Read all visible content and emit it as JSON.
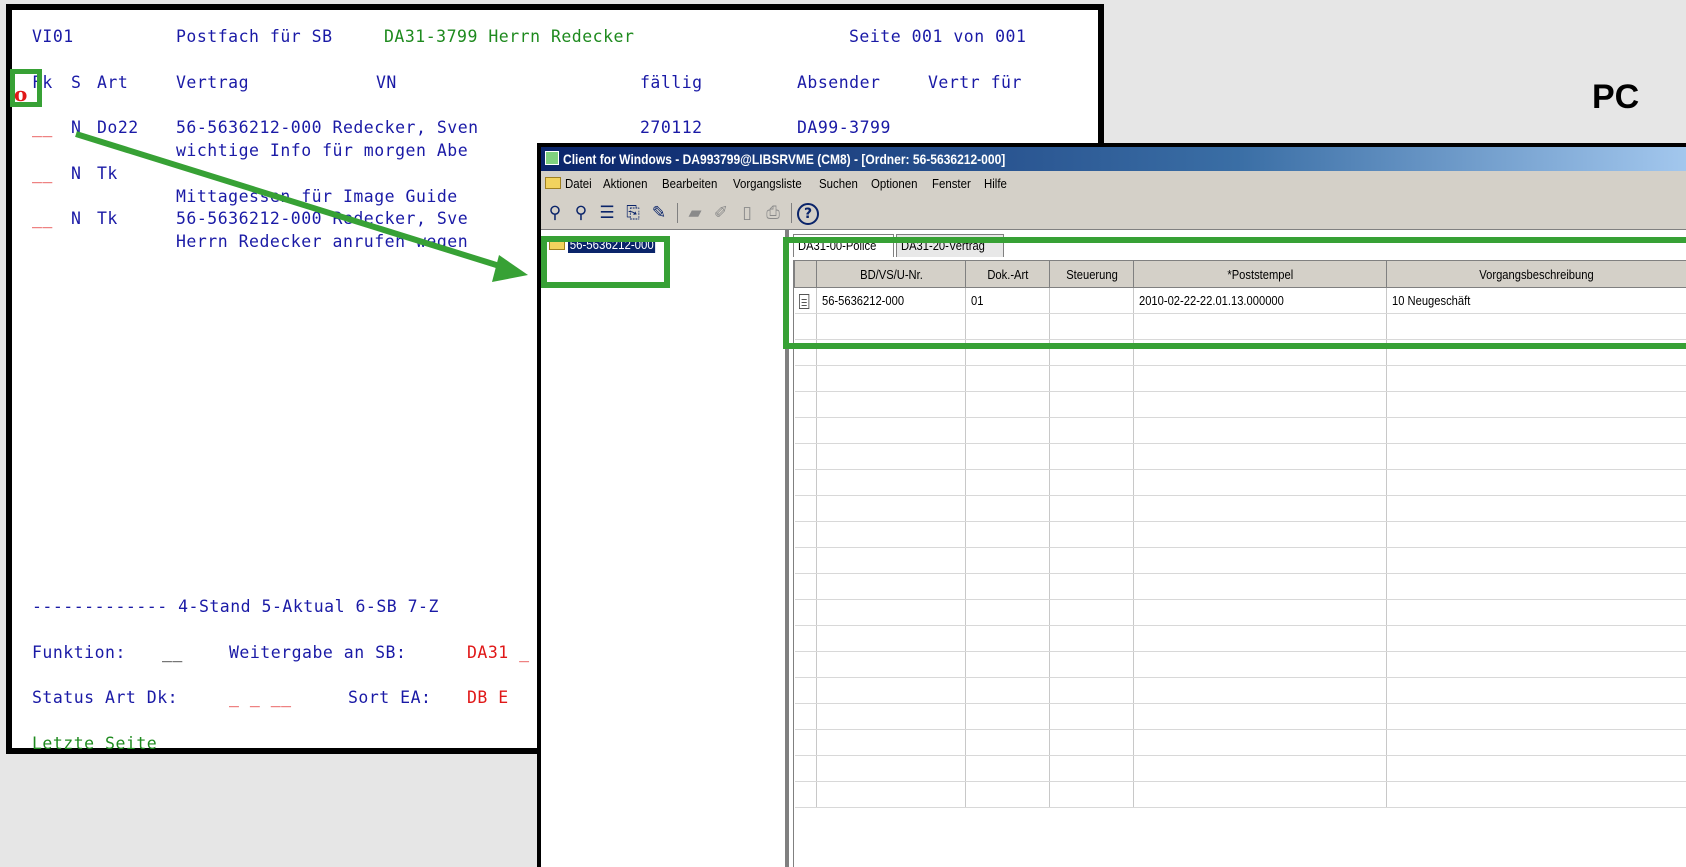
{
  "terminal": {
    "header": {
      "screen_id": "VI01",
      "title_prefix": "Postfach für SB",
      "sb_user": "DA31-3799 Herrn Redecker",
      "page": "Seite 001 von 001"
    },
    "columns": {
      "c1": "Fk",
      "c2": "S",
      "c3": "Art",
      "c4": "Vertrag",
      "c5": "VN",
      "c6": "fällig",
      "c7": "Absender",
      "c8": "Vertr für"
    },
    "marker_letter": "o",
    "rows": [
      {
        "fk": "__",
        "s": "N",
        "art": "Do22",
        "line1": "56-5636212-000 Redecker, Sven",
        "faellig": "270112",
        "absender": "DA99-3799",
        "line2": "wichtige Info für morgen Abe"
      },
      {
        "fk": "__",
        "s": "N",
        "art": "Tk",
        "line1": "",
        "faellig": "",
        "absender": "",
        "line2": "Mittagessen für Image Guide"
      },
      {
        "fk": "__",
        "s": "N",
        "art": "Tk",
        "line1": "56-5636212-000 Redecker, Sve",
        "faellig": "",
        "absender": "",
        "line2": "Herrn Redecker anrufen wegen"
      }
    ],
    "footer": {
      "pf_keys": "------------- 4-Stand 5-Aktual 6-SB 7-Z",
      "funktion_label": "Funktion:",
      "funktion_value": "__",
      "weitergabe_label": "Weitergabe an SB:",
      "weitergabe_value": "DA31 _",
      "status_label": "Status Art Dk:",
      "status_value": "_ _ __",
      "sort_label": "Sort EA:",
      "sort_value": "DB E",
      "message": "Letzte Seite"
    }
  },
  "pc_label": "PC",
  "client": {
    "title": "Client for Windows - DA993799@LIBSRVME (CM8) - [Ordner: 56-5636212-000]",
    "menu": [
      "Datei",
      "Aktionen",
      "Bearbeiten",
      "Vorgangsliste",
      "Suchen",
      "Optionen",
      "Fenster",
      "Hilfe"
    ],
    "toolbar_icons": [
      "binoculars-icon",
      "binoculars-plus-icon",
      "list-icon",
      "document-export-icon",
      "eraser-icon",
      "folder-icon",
      "document-edit-icon",
      "clipboard-icon",
      "print-icon",
      "help-icon"
    ],
    "tree_item": "56-5636212-000",
    "tabs": [
      "DA31-00-Police",
      "DA31-20-Vertrag"
    ],
    "grid_headers": [
      "BD/VS/U-Nr.",
      "Dok.-Art",
      "Steuerung",
      "*Poststempel",
      "Vorgangsbeschreibung"
    ],
    "grid_rows": [
      {
        "nr": "56-5636212-000",
        "dokart": "01",
        "steuerung": "",
        "poststempel": "2010-02-22-22.01.13.000000",
        "beschreibung": "10 Neugeschäft"
      }
    ]
  },
  "colors": {
    "highlight_green": "#37a135",
    "terminal_blue": "#1a1aa6",
    "terminal_green": "#1e8a1e",
    "terminal_red": "#e01818"
  }
}
